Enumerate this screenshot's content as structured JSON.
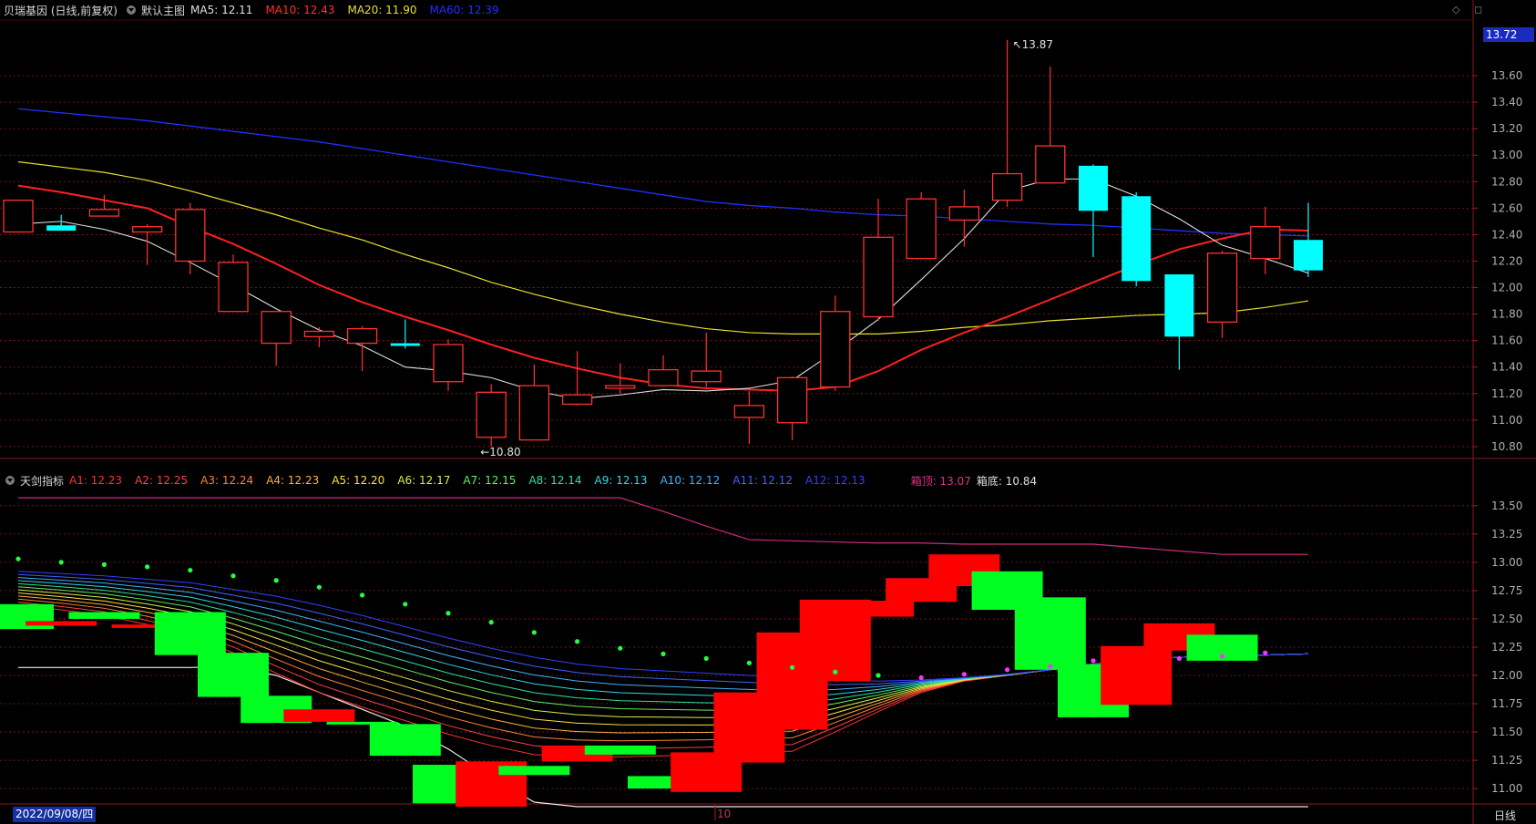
{
  "main_header": {
    "stock_title": "贝瑞基因 (日线,前复权)",
    "main_chart_label": "默认主图",
    "ma": [
      {
        "label": "MA5: 12.11",
        "color": "#e0e0e0"
      },
      {
        "label": "MA10: 12.43",
        "color": "#ff3030"
      },
      {
        "label": "MA20: 11.90",
        "color": "#e8e030"
      },
      {
        "label": "MA60: 12.39",
        "color": "#2030ff"
      }
    ]
  },
  "sub_header": {
    "indicator_name": "天剑指标",
    "a_values": [
      {
        "label": "A1: 12.23",
        "color": "#ff3030"
      },
      {
        "label": "A2: 12.25",
        "color": "#ff4040"
      },
      {
        "label": "A3: 12.24",
        "color": "#ff8030"
      },
      {
        "label": "A4: 12.23",
        "color": "#ffb040"
      },
      {
        "label": "A5: 12.20",
        "color": "#ffe040"
      },
      {
        "label": "A6: 12.17",
        "color": "#d8f040"
      },
      {
        "label": "A7: 12.15",
        "color": "#60f060"
      },
      {
        "label": "A8: 12.14",
        "color": "#30e0a0"
      },
      {
        "label": "A9: 12.13",
        "color": "#30d8e0"
      },
      {
        "label": "A10: 12.12",
        "color": "#40b0ff"
      },
      {
        "label": "A11: 12.12",
        "color": "#4060ff"
      },
      {
        "label": "A12: 12.13",
        "color": "#3040ff"
      }
    ],
    "box_top": {
      "label": "箱顶: 13.07",
      "color": "#e0308a"
    },
    "box_bottom": {
      "label": "箱底: 10.84",
      "color": "#e0e0e0"
    }
  },
  "price_tag": "13.72",
  "date_label": "2022/09/08/四",
  "month_label": "10",
  "period_button": "日线",
  "corner_icons": "◇ ◻",
  "colors": {
    "up": "#ff3030",
    "down": "#00ffff",
    "ma5": "#e0e0e0",
    "ma10": "#ff2020",
    "ma20": "#e8e030",
    "ma60": "#2030ff",
    "grid": "#8a1a1a",
    "axis_text": "#b0b0b0",
    "sub_up": "#ff0000",
    "sub_down": "#00ff20"
  },
  "chart_data": [
    {
      "type": "candlestick",
      "title": "贝瑞基因 (日线,前复权)",
      "y_ticks": [
        "13.60",
        "13.40",
        "13.20",
        "13.00",
        "12.80",
        "12.60",
        "12.40",
        "12.20",
        "12.00",
        "11.80",
        "11.60",
        "11.40",
        "11.20",
        "11.00",
        "10.80"
      ],
      "ylim": [
        10.71,
        14.02
      ],
      "candles": [
        {
          "o": 12.42,
          "h": 12.66,
          "l": 12.42,
          "c": 12.66
        },
        {
          "o": 12.47,
          "h": 12.55,
          "l": 12.45,
          "c": 12.43
        },
        {
          "o": 12.54,
          "h": 12.7,
          "l": 12.54,
          "c": 12.59
        },
        {
          "o": 12.42,
          "h": 12.48,
          "l": 12.17,
          "c": 12.46
        },
        {
          "o": 12.2,
          "h": 12.64,
          "l": 12.1,
          "c": 12.59
        },
        {
          "o": 11.82,
          "h": 12.25,
          "l": 11.82,
          "c": 12.19
        },
        {
          "o": 11.58,
          "h": 11.82,
          "l": 11.41,
          "c": 11.82
        },
        {
          "o": 11.63,
          "h": 11.7,
          "l": 11.55,
          "c": 11.67
        },
        {
          "o": 11.58,
          "h": 11.71,
          "l": 11.37,
          "c": 11.69
        },
        {
          "o": 11.58,
          "h": 11.76,
          "l": 11.54,
          "c": 11.56
        },
        {
          "o": 11.29,
          "h": 11.61,
          "l": 11.22,
          "c": 11.57
        },
        {
          "o": 10.87,
          "h": 11.27,
          "l": 10.8,
          "c": 11.21
        },
        {
          "o": 10.85,
          "h": 11.42,
          "l": 10.85,
          "c": 11.26
        },
        {
          "o": 11.12,
          "h": 11.52,
          "l": 11.11,
          "c": 11.19
        },
        {
          "o": 11.24,
          "h": 11.43,
          "l": 11.2,
          "c": 11.26
        },
        {
          "o": 11.26,
          "h": 11.49,
          "l": 11.26,
          "c": 11.38
        },
        {
          "o": 11.29,
          "h": 11.66,
          "l": 11.25,
          "c": 11.37
        },
        {
          "o": 11.02,
          "h": 11.22,
          "l": 10.82,
          "c": 11.11
        },
        {
          "o": 10.98,
          "h": 11.33,
          "l": 10.85,
          "c": 11.32
        },
        {
          "o": 11.25,
          "h": 11.94,
          "l": 11.22,
          "c": 11.82
        },
        {
          "o": 11.78,
          "h": 12.67,
          "l": 11.75,
          "c": 12.38
        },
        {
          "o": 12.22,
          "h": 12.72,
          "l": 12.22,
          "c": 12.67
        },
        {
          "o": 12.51,
          "h": 12.74,
          "l": 12.31,
          "c": 12.61
        },
        {
          "o": 12.66,
          "h": 13.87,
          "l": 12.61,
          "c": 12.86
        },
        {
          "o": 12.79,
          "h": 13.67,
          "l": 12.79,
          "c": 13.07
        },
        {
          "o": 12.92,
          "h": 12.93,
          "l": 12.23,
          "c": 12.58
        },
        {
          "o": 12.69,
          "h": 12.72,
          "l": 12.01,
          "c": 12.05
        },
        {
          "o": 12.1,
          "h": 12.1,
          "l": 11.38,
          "c": 11.63
        },
        {
          "o": 11.74,
          "h": 12.28,
          "l": 11.62,
          "c": 12.26
        },
        {
          "o": 12.22,
          "h": 12.61,
          "l": 12.1,
          "c": 12.46
        },
        {
          "o": 12.36,
          "h": 12.64,
          "l": 12.08,
          "c": 12.13
        }
      ],
      "ma5": [
        12.48,
        12.5,
        12.44,
        12.35,
        12.19,
        12.02,
        11.84,
        11.68,
        11.56,
        11.4,
        11.37,
        11.32,
        11.22,
        11.16,
        11.19,
        11.23,
        11.22,
        11.24,
        11.3,
        11.52,
        11.76,
        12.06,
        12.37,
        12.73,
        12.82,
        12.82,
        12.69,
        12.52,
        12.32,
        12.22,
        12.11
      ],
      "ma10": [
        12.77,
        12.72,
        12.66,
        12.6,
        12.46,
        12.33,
        12.18,
        12.02,
        11.89,
        11.78,
        11.68,
        11.57,
        11.47,
        11.39,
        11.32,
        11.27,
        11.24,
        11.23,
        11.22,
        11.25,
        11.37,
        11.53,
        11.66,
        11.78,
        11.91,
        12.04,
        12.17,
        12.29,
        12.37,
        12.44,
        12.43
      ],
      "ma20": [
        12.95,
        12.91,
        12.87,
        12.81,
        12.73,
        12.64,
        12.55,
        12.45,
        12.36,
        12.25,
        12.15,
        12.04,
        11.95,
        11.87,
        11.8,
        11.74,
        11.69,
        11.66,
        11.65,
        11.65,
        11.65,
        11.67,
        11.7,
        11.72,
        11.75,
        11.77,
        11.79,
        11.8,
        11.81,
        11.85,
        11.9
      ],
      "ma60": [
        13.35,
        13.32,
        13.29,
        13.26,
        13.22,
        13.18,
        13.14,
        13.1,
        13.05,
        13.0,
        12.95,
        12.9,
        12.85,
        12.8,
        12.75,
        12.7,
        12.65,
        12.62,
        12.6,
        12.57,
        12.55,
        12.54,
        12.52,
        12.5,
        12.48,
        12.47,
        12.45,
        12.43,
        12.41,
        12.4,
        12.39
      ],
      "annotations": [
        {
          "text": "13.87",
          "index": 23,
          "value": 13.87
        },
        {
          "text": "10.80",
          "index": 11,
          "value": 10.8
        }
      ]
    },
    {
      "type": "bar",
      "title": "天剑指标",
      "y_ticks": [
        "13.50",
        "13.25",
        "13.00",
        "12.75",
        "12.50",
        "12.25",
        "12.00",
        "11.75",
        "11.50",
        "11.25",
        "11.00"
      ],
      "ylim": [
        10.88,
        13.7
      ],
      "box_top": [
        13.57,
        13.57,
        13.57,
        13.57,
        13.57,
        13.57,
        13.57,
        13.57,
        13.57,
        13.57,
        13.57,
        13.57,
        13.57,
        13.57,
        13.57,
        13.45,
        13.32,
        13.2,
        13.19,
        13.18,
        13.17,
        13.17,
        13.16,
        13.16,
        13.16,
        13.16,
        13.13,
        13.1,
        13.07,
        13.07,
        13.07
      ],
      "box_bottom": [
        12.07,
        12.07,
        12.07,
        12.07,
        12.07,
        12.08,
        12.0,
        11.85,
        11.7,
        11.55,
        11.35,
        11.1,
        10.88,
        10.84,
        10.84,
        10.84,
        10.84,
        10.84,
        10.84,
        10.84,
        10.84,
        10.84,
        10.84,
        10.84,
        10.84,
        10.84,
        10.84,
        10.84,
        10.84,
        10.84,
        10.84
      ],
      "green_dots": [
        13.03,
        13.0,
        12.98,
        12.96,
        12.93,
        12.88,
        12.84,
        12.78,
        12.71,
        12.63,
        12.55,
        12.47,
        12.38,
        12.3,
        12.24,
        12.19,
        12.15,
        12.11,
        12.07,
        12.03,
        12.0
      ],
      "magenta_dots": [
        {
          "index": 21,
          "value": 11.98
        },
        {
          "index": 22,
          "value": 12.01
        },
        {
          "index": 23,
          "value": 12.05
        },
        {
          "index": 24,
          "value": 12.08
        },
        {
          "index": 25,
          "value": 12.13
        },
        {
          "index": 27,
          "value": 12.15
        },
        {
          "index": 28,
          "value": 12.17
        },
        {
          "index": 29,
          "value": 12.2
        }
      ],
      "ribbon_top": [
        12.92,
        12.9,
        12.88,
        12.85,
        12.82,
        12.76,
        12.7,
        12.62,
        12.53,
        12.43,
        12.33,
        12.24,
        12.16,
        12.1,
        12.06,
        12.04,
        12.02,
        12.0,
        11.98,
        11.96,
        11.95,
        11.96,
        11.98,
        12.01,
        12.05,
        12.1,
        12.14,
        12.16,
        12.17,
        12.18,
        12.19
      ],
      "ribbon_bottom": [
        12.62,
        12.58,
        12.53,
        12.45,
        12.35,
        12.2,
        12.02,
        11.85,
        11.72,
        11.6,
        11.48,
        11.38,
        11.3,
        11.28,
        11.28,
        11.29,
        11.3,
        11.32,
        11.33,
        11.5,
        11.68,
        11.85,
        11.95,
        12.0,
        12.05,
        12.1,
        12.14,
        12.16,
        12.17,
        12.18,
        12.19
      ],
      "bars": [
        {
          "top": 12.63,
          "bottom": 12.41,
          "up": false
        },
        {
          "top": 12.48,
          "bottom": 12.44,
          "up": true
        },
        {
          "top": 12.56,
          "bottom": 12.5,
          "up": false
        },
        {
          "top": 12.45,
          "bottom": 12.42,
          "up": true
        },
        {
          "top": 12.56,
          "bottom": 12.18,
          "up": false
        },
        {
          "top": 12.2,
          "bottom": 11.81,
          "up": false
        },
        {
          "top": 11.82,
          "bottom": 11.58,
          "up": false
        },
        {
          "top": 11.7,
          "bottom": 11.59,
          "up": true
        },
        {
          "top": 11.59,
          "bottom": 11.57,
          "up": false
        },
        {
          "top": 11.57,
          "bottom": 11.29,
          "up": false
        },
        {
          "top": 11.21,
          "bottom": 10.87,
          "up": false
        },
        {
          "top": 11.24,
          "bottom": 10.84,
          "up": true
        },
        {
          "top": 11.2,
          "bottom": 11.12,
          "up": false
        },
        {
          "top": 11.38,
          "bottom": 11.24,
          "up": true
        },
        {
          "top": 11.38,
          "bottom": 11.3,
          "up": false
        },
        {
          "top": 11.11,
          "bottom": 11.0,
          "up": false
        },
        {
          "top": 11.32,
          "bottom": 10.97,
          "up": true
        },
        {
          "top": 11.85,
          "bottom": 11.23,
          "up": true
        },
        {
          "top": 12.38,
          "bottom": 11.52,
          "up": true
        },
        {
          "top": 12.67,
          "bottom": 11.95,
          "up": true
        },
        {
          "top": 12.66,
          "bottom": 12.52,
          "up": true
        },
        {
          "top": 12.86,
          "bottom": 12.65,
          "up": true
        },
        {
          "top": 13.07,
          "bottom": 12.79,
          "up": true
        },
        {
          "top": 12.92,
          "bottom": 12.58,
          "up": false
        },
        {
          "top": 12.69,
          "bottom": 12.05,
          "up": false
        },
        {
          "top": 12.1,
          "bottom": 11.63,
          "up": false
        },
        {
          "top": 12.26,
          "bottom": 11.74,
          "up": true
        },
        {
          "top": 12.46,
          "bottom": 12.22,
          "up": true
        },
        {
          "top": 12.36,
          "bottom": 12.13,
          "up": false
        }
      ]
    }
  ]
}
